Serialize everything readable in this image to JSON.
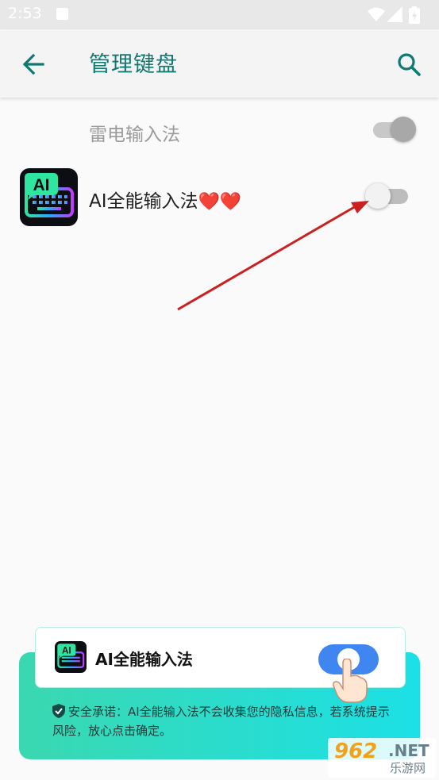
{
  "status_bar": {
    "time": "2:53"
  },
  "header": {
    "title": "管理键盘",
    "back_icon": "arrow-left-icon",
    "search_icon": "search-icon"
  },
  "keyboards": [
    {
      "label": "雷电输入法",
      "enabled": true,
      "disabled_style": true
    },
    {
      "label": "AI全能输入法",
      "hearts": "❤️❤️",
      "enabled": false,
      "icon_text": "AI"
    }
  ],
  "guide": {
    "app_name": "AI全能输入法",
    "icon_text": "AI",
    "toggle_on": true,
    "note": "安全承诺：AI全能输入法不会收集您的隐私信息，若系统提示风险，放心点击确定。"
  },
  "watermark": {
    "main": "962",
    "net": ".NET",
    "sub": "乐游网"
  },
  "colors": {
    "accent": "#0f7a72",
    "arrow": "#cc1f1f",
    "panel": "#22dccf",
    "toggle": "#3f86f0"
  }
}
